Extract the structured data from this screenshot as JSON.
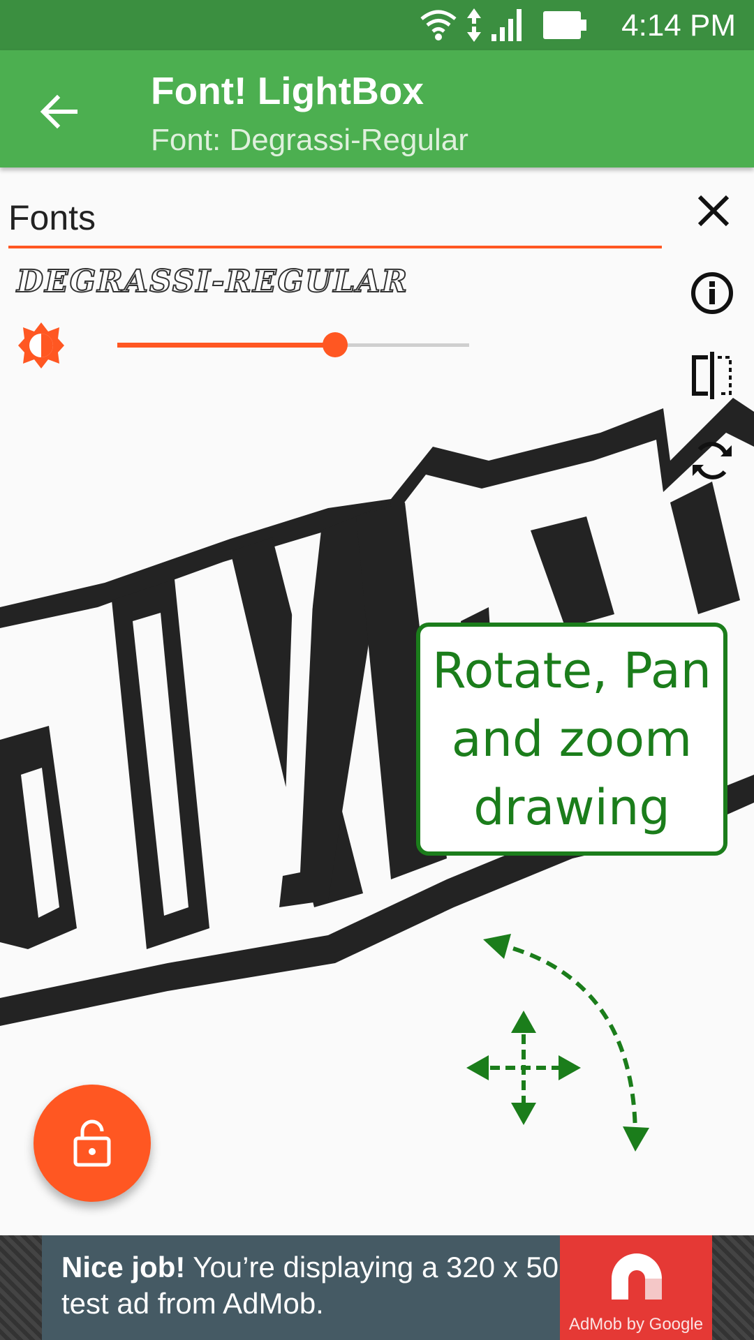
{
  "status_bar": {
    "time": "4:14 PM",
    "icons": [
      "wifi-icon",
      "data-arrows-icon",
      "signal-icon",
      "battery-icon"
    ]
  },
  "app_bar": {
    "title": "Font! LightBox",
    "subtitle": "Font: Degrassi-Regular",
    "back_icon": "arrow-back-icon"
  },
  "search": {
    "value": "Fonts"
  },
  "font_preview": {
    "text": "DEGRASSI-REGULAR"
  },
  "brightness": {
    "icon": "brightness-icon",
    "level": 0.62
  },
  "side_actions": [
    "close-icon",
    "info-icon",
    "flip-icon",
    "rotate-icon"
  ],
  "tip": {
    "lines": [
      "Rotate, Pan",
      "and zoom",
      "drawing"
    ]
  },
  "fab": {
    "icon": "lock-open-icon"
  },
  "ad": {
    "headline": "Nice job!",
    "body": " You’re displaying a 320 x 50 test ad from AdMob.",
    "logo_caption": "AdMob by Google"
  },
  "colors": {
    "primary": "#4caf50",
    "primary_dark": "#3b8f40",
    "accent": "#ff5722",
    "tip_green": "#1b7d1b"
  }
}
